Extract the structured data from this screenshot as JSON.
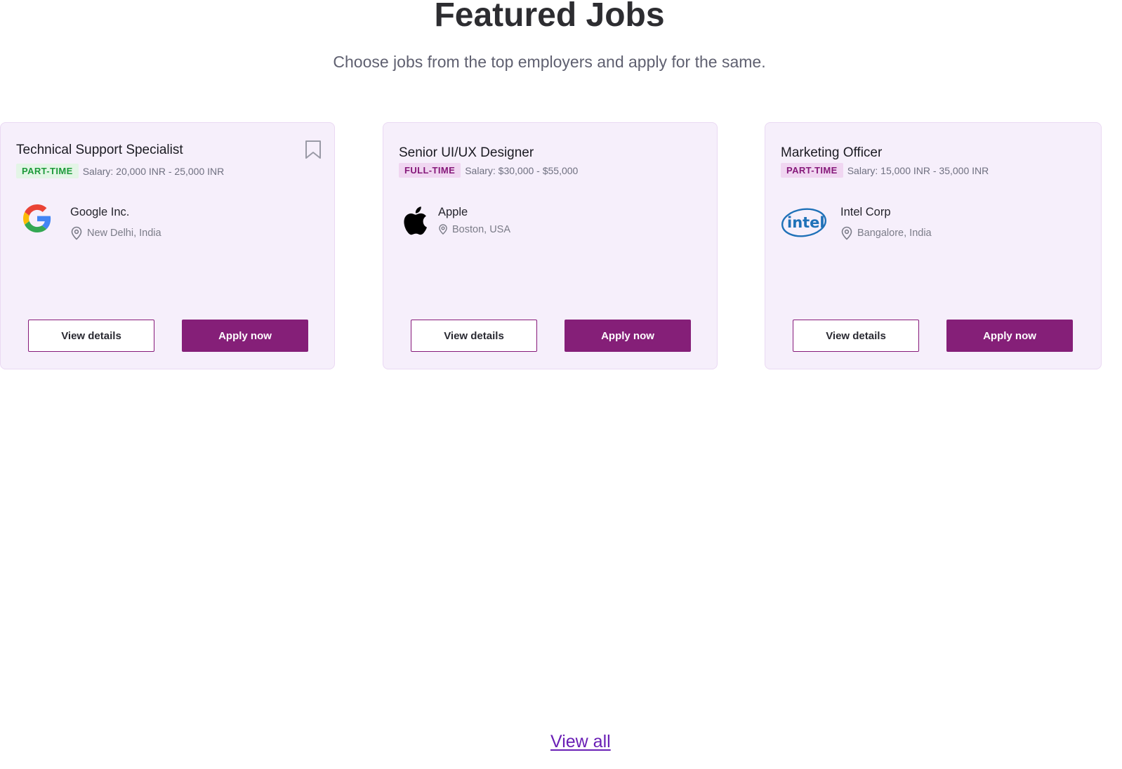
{
  "header": {
    "title": "Featured Jobs",
    "subtitle": "Choose jobs from the top employers and apply for the same."
  },
  "jobs": [
    {
      "title": "Technical Support Specialist",
      "type": "PART-TIME",
      "type_color": "#1d9a3a",
      "salary": "Salary: 20,000 INR - 25,000 INR",
      "company": "Google Inc.",
      "location": "New Delhi, India",
      "logo_icon": "google-logo-icon",
      "bookmark_icon": "bookmark-icon",
      "view_label": "View details",
      "apply_label": "Apply now"
    },
    {
      "title": "Senior UI/UX Designer",
      "type": "FULL-TIME",
      "type_color": "#86197a",
      "salary": "Salary: $30,000 - $55,000",
      "company": "Apple",
      "location": "Boston, USA",
      "logo_icon": "apple-logo-icon",
      "view_label": "View details",
      "apply_label": "Apply now"
    },
    {
      "title": "Marketing Officer",
      "type": "PART-TIME",
      "type_color": "#86197a",
      "salary": "Salary: 15,000 INR - 35,000 INR",
      "company": "Intel Corp",
      "location": "Bangalore, India",
      "logo_icon": "intel-logo-icon",
      "view_label": "View details",
      "apply_label": "Apply now"
    }
  ],
  "footer": {
    "view_all_label": "View all"
  },
  "colors": {
    "accent": "#851f78",
    "card_bg": "#f6effb",
    "link": "#6a1fb5"
  }
}
